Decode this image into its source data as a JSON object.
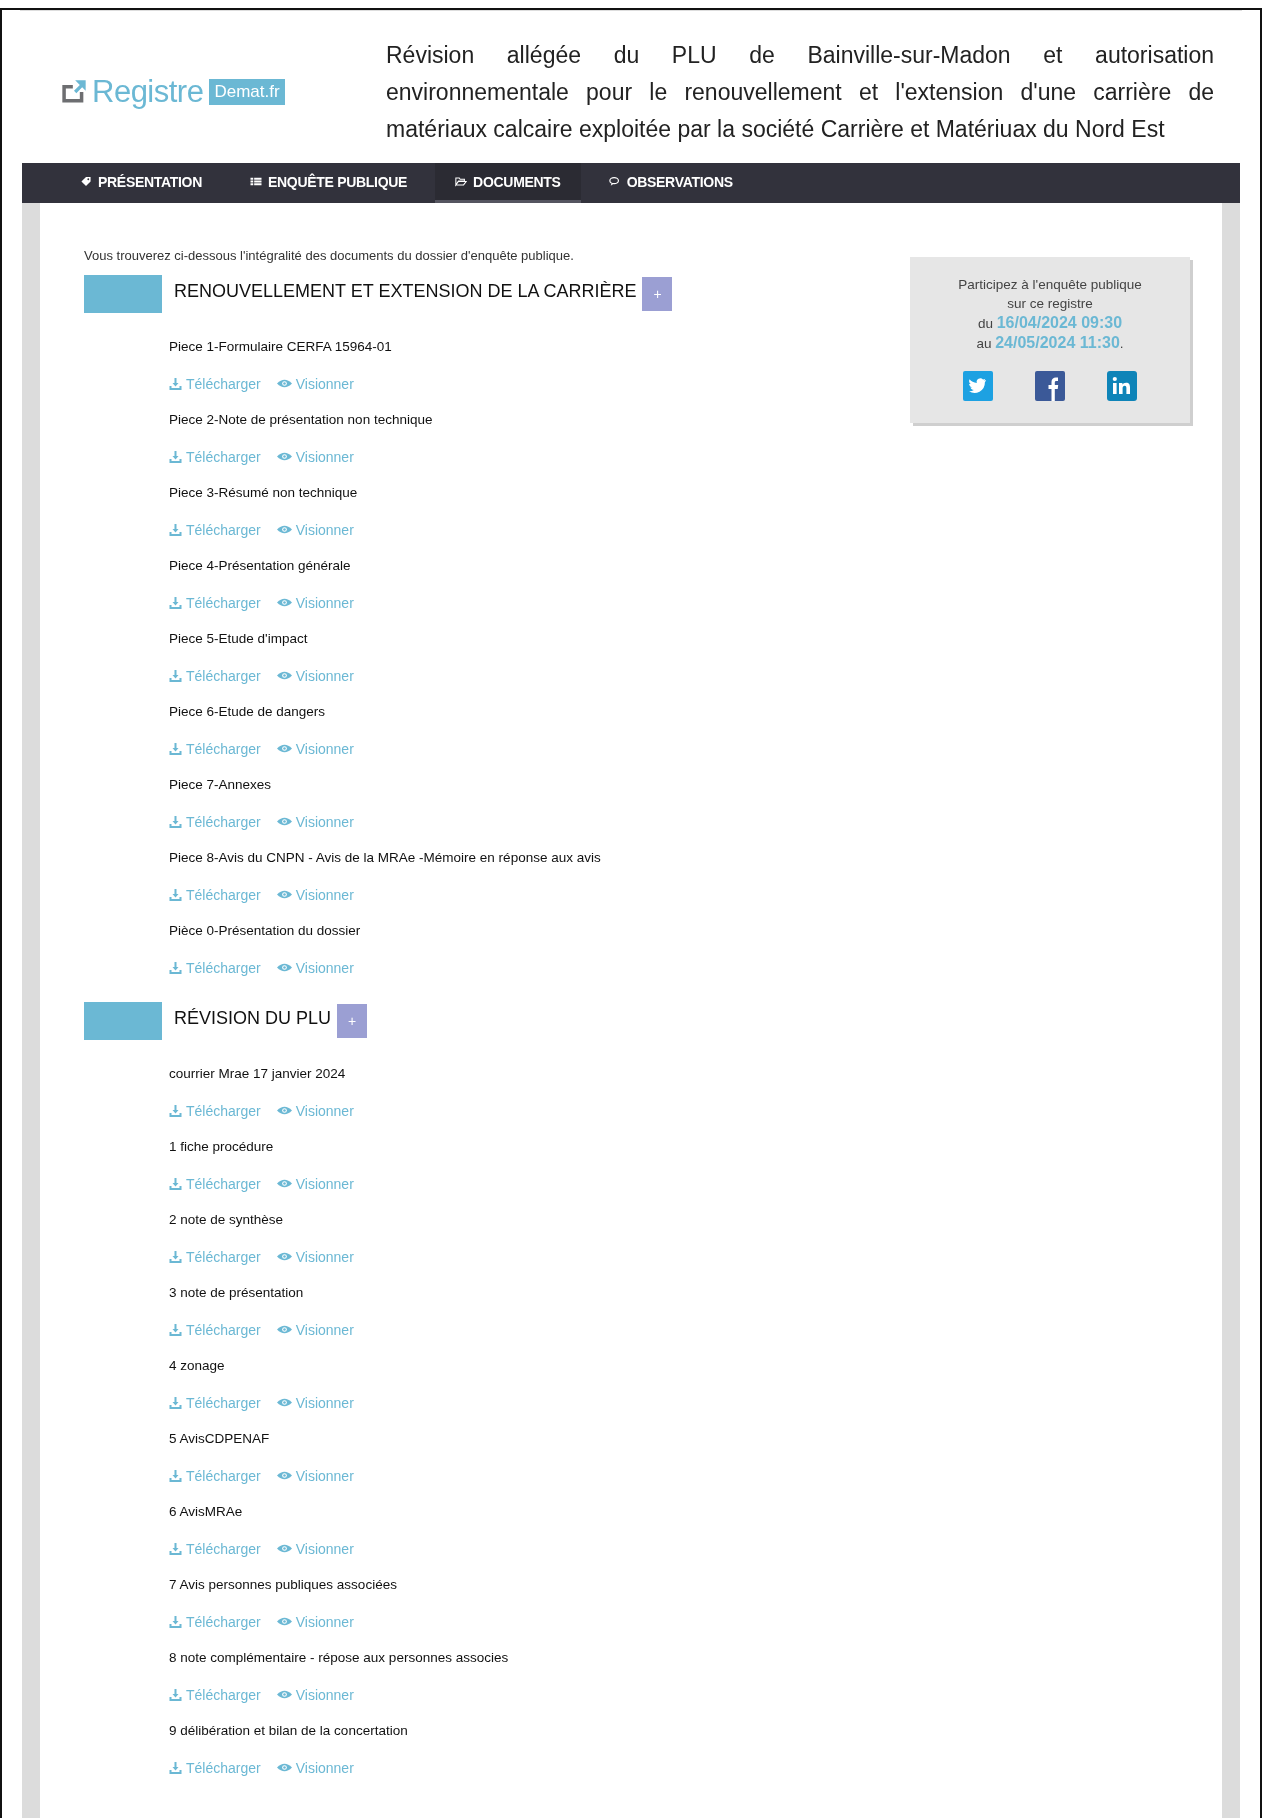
{
  "header": {
    "logo": {
      "word": "Registre",
      "badge": "Demat.fr"
    },
    "title": "Révision allégée du PLU de Bainville-sur-Madon et autorisation environnementale pour le renouvellement et l'extension d'une carrière de matériaux calcaire exploitée par la société Carrière et Matériuax du Nord Est"
  },
  "tabs": [
    {
      "label": "PRÉSENTATION",
      "selected": false
    },
    {
      "label": "ENQUÊTE PUBLIQUE",
      "selected": false
    },
    {
      "label": "DOCUMENTS",
      "selected": true
    },
    {
      "label": "OBSERVATIONS",
      "selected": false
    }
  ],
  "intro": "Vous trouverez ci-dessous l'intégralité des documents du dossier d'enquête publique.",
  "sections": [
    {
      "title": "RENOUVELLEMENT ET EXTENSION DE LA CARRIÈRE",
      "toggle": "+",
      "items": [
        {
          "name": "Piece 1-Formulaire CERFA 15964-01",
          "download": "Télécharger",
          "view": "Visionner"
        },
        {
          "name": "Piece 2-Note de présentation non technique",
          "download": "Télécharger",
          "view": "Visionner"
        },
        {
          "name": "Piece 3-Résumé non technique",
          "download": "Télécharger",
          "view": "Visionner"
        },
        {
          "name": "Piece 4-Présentation générale",
          "download": "Télécharger",
          "view": "Visionner"
        },
        {
          "name": "Piece 5-Etude d'impact",
          "download": "Télécharger",
          "view": "Visionner"
        },
        {
          "name": "Piece 6-Etude de dangers",
          "download": "Télécharger",
          "view": "Visionner"
        },
        {
          "name": "Piece 7-Annexes",
          "download": "Télécharger",
          "view": "Visionner"
        },
        {
          "name": "Piece 8-Avis du CNPN - Avis de la MRAe -Mémoire en réponse aux avis",
          "download": "Télécharger",
          "view": "Visionner"
        },
        {
          "name": "Pièce 0-Présentation du dossier",
          "download": "Télécharger",
          "view": "Visionner"
        }
      ]
    },
    {
      "title": "RÉVISION DU PLU",
      "toggle": "+",
      "items": [
        {
          "name": "courrier Mrae 17 janvier 2024",
          "download": "Télécharger",
          "view": "Visionner"
        },
        {
          "name": "1 fiche procédure",
          "download": "Télécharger",
          "view": "Visionner"
        },
        {
          "name": "2 note de synthèse",
          "download": "Télécharger",
          "view": "Visionner"
        },
        {
          "name": "3 note de présentation",
          "download": "Télécharger",
          "view": "Visionner"
        },
        {
          "name": "4 zonage",
          "download": "Télécharger",
          "view": "Visionner"
        },
        {
          "name": "5 AvisCDPENAF",
          "download": "Télécharger",
          "view": "Visionner"
        },
        {
          "name": "6 AvisMRAe",
          "download": "Télécharger",
          "view": "Visionner"
        },
        {
          "name": "7 Avis personnes publiques associées",
          "download": "Télécharger",
          "view": "Visionner"
        },
        {
          "name": "8 note complémentaire - répose aux personnes associes",
          "download": "Télécharger",
          "view": "Visionner"
        },
        {
          "name": "9 délibération et bilan de la concertation",
          "download": "Télécharger",
          "view": "Visionner"
        }
      ]
    }
  ],
  "participate": {
    "lines": [
      "Participez à l'enquête publique",
      "sur ce registre"
    ],
    "from_label": "du",
    "from_date": "16/04/2024 09:30",
    "to_label": "au",
    "to_date": "24/05/2024 11:30",
    "end": "."
  }
}
